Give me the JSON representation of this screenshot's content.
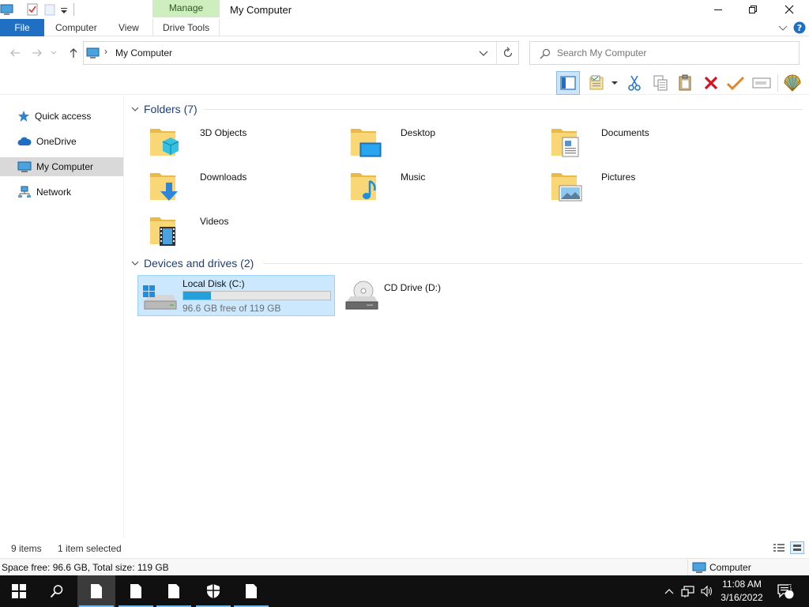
{
  "window": {
    "title": "My Computer",
    "context_tab": "Manage"
  },
  "ribbon": {
    "tabs": [
      {
        "label": "File"
      },
      {
        "label": "Computer"
      },
      {
        "label": "View"
      },
      {
        "label": "Drive Tools"
      }
    ]
  },
  "address": {
    "path": "My Computer",
    "search_placeholder": "Search My Computer"
  },
  "nav": {
    "items": [
      {
        "label": "Quick access",
        "icon": "star-icon"
      },
      {
        "label": "OneDrive",
        "icon": "cloud-icon"
      },
      {
        "label": "My Computer",
        "icon": "computer-icon",
        "selected": true
      },
      {
        "label": "Network",
        "icon": "network-icon"
      }
    ]
  },
  "folders": {
    "header": "Folders (7)",
    "items": [
      {
        "label": "3D Objects",
        "icon": "3d-objects-folder-icon"
      },
      {
        "label": "Desktop",
        "icon": "desktop-folder-icon"
      },
      {
        "label": "Documents",
        "icon": "documents-folder-icon"
      },
      {
        "label": "Downloads",
        "icon": "downloads-folder-icon"
      },
      {
        "label": "Music",
        "icon": "music-folder-icon"
      },
      {
        "label": "Pictures",
        "icon": "pictures-folder-icon"
      },
      {
        "label": "Videos",
        "icon": "videos-folder-icon"
      }
    ]
  },
  "drives": {
    "header": "Devices and drives (2)",
    "items": [
      {
        "label": "Local Disk (C:)",
        "free_text": "96.6 GB free of 119 GB",
        "used_fraction": 0.19,
        "selected": true,
        "icon": "hard-drive-icon"
      },
      {
        "label": "CD Drive (D:)",
        "icon": "cd-drive-icon"
      }
    ]
  },
  "status": {
    "items_count": "9 items",
    "selected_count": "1 item selected"
  },
  "info": {
    "space": "Space free: 96.6 GB, Total size: 119 GB",
    "location": "Computer"
  },
  "taskbar": {
    "time": "11:08 AM",
    "date": "3/16/2022",
    "notification_count": "2"
  },
  "colors": {
    "accent": "#1f6fc4",
    "manage_tab": "#cfeec0",
    "selection": "#cce8ff",
    "progress": "#26a0da"
  }
}
